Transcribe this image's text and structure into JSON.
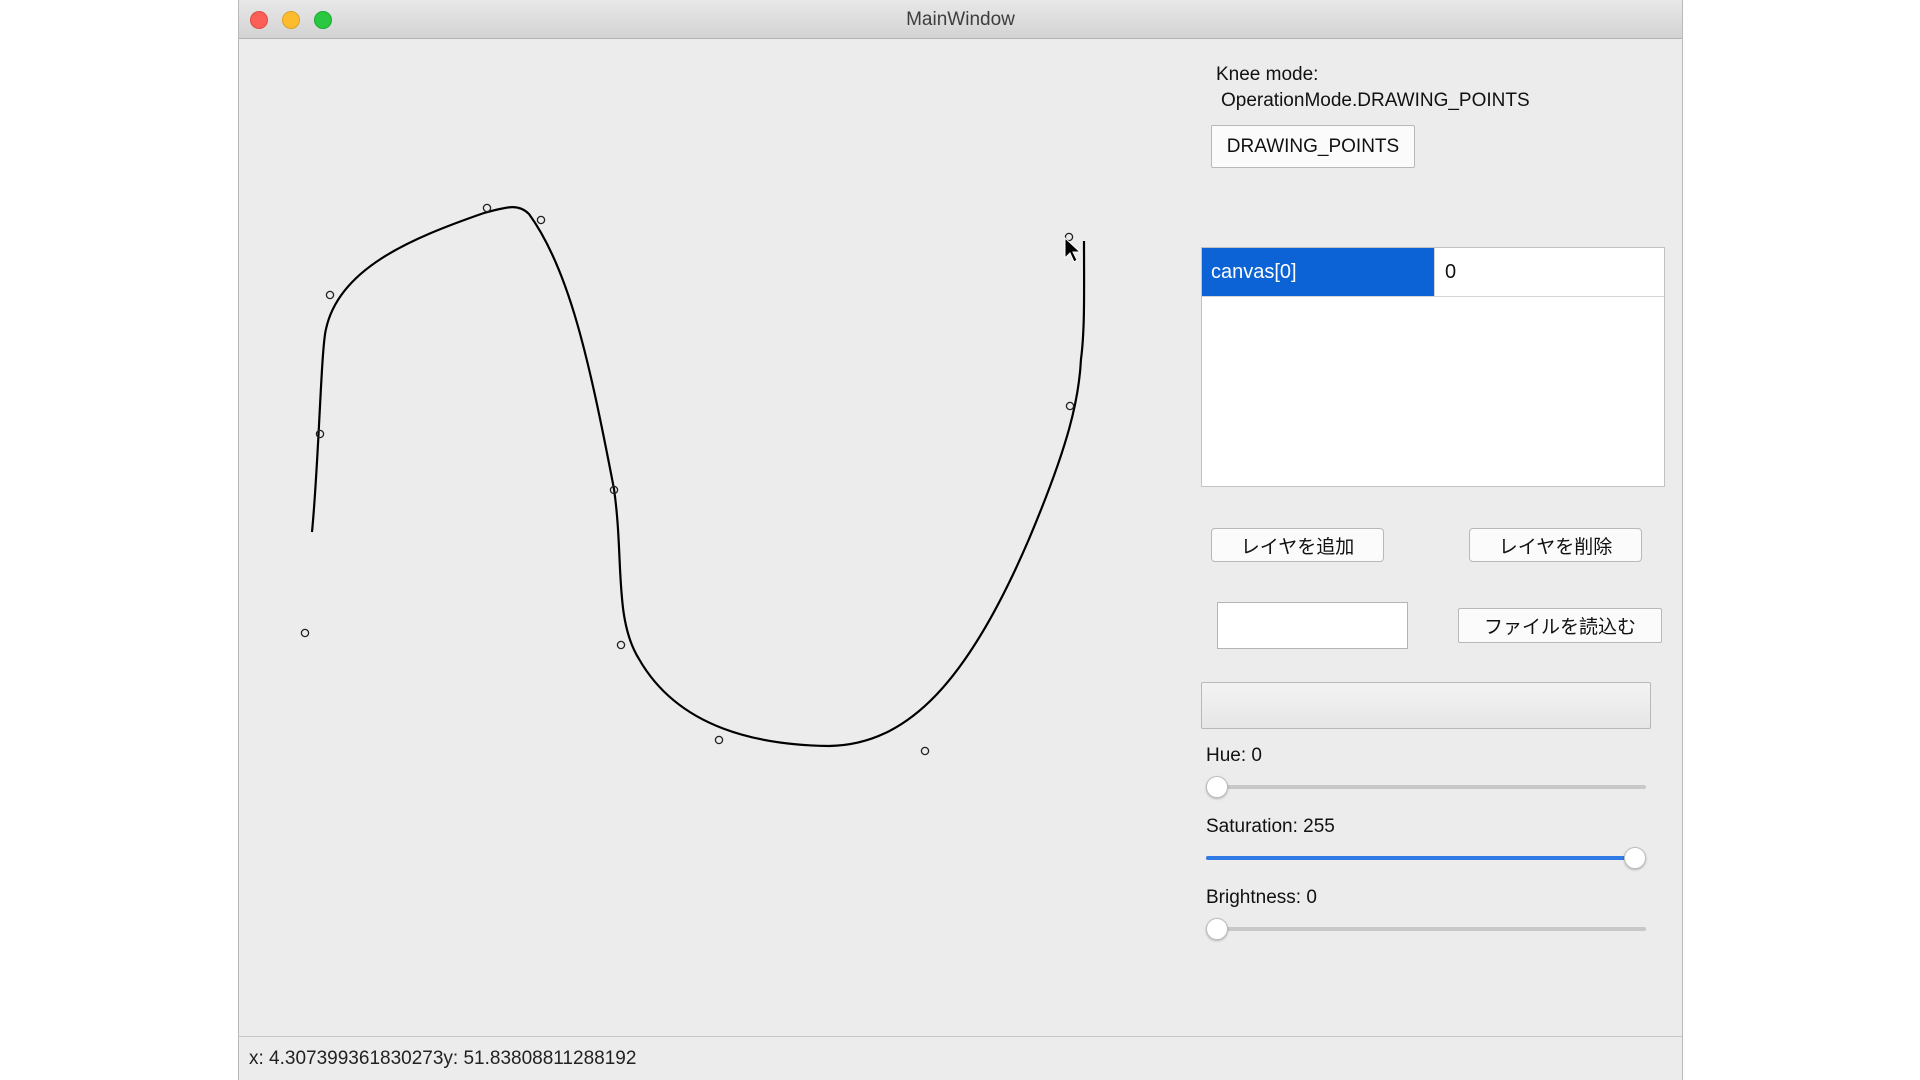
{
  "window": {
    "title": "MainWindow"
  },
  "mode": {
    "label_line1": "Knee mode:",
    "label_line2": "OperationMode.DRAWING_POINTS",
    "button_label": "DRAWING_POINTS"
  },
  "layers": {
    "rows": [
      {
        "name": "canvas[0]",
        "value": "0"
      }
    ]
  },
  "layer_buttons": {
    "add_label": "レイヤを追加",
    "delete_label": "レイヤを削除"
  },
  "file": {
    "input_value": "",
    "read_label": "ファイルを読込む"
  },
  "progress": {
    "value": 0
  },
  "sliders": {
    "hue": {
      "label": "Hue: 0",
      "value": 0,
      "max": 255
    },
    "saturation": {
      "label": "Saturation: 255",
      "value": 255,
      "max": 255
    },
    "brightness": {
      "label": "Brightness: 0",
      "value": 0,
      "max": 255
    }
  },
  "status": {
    "text": "x: 4.307399361830273y: 51.83808811288192"
  },
  "colors": {
    "selection": "#0b63d6",
    "slider_accent": "#2f7ae5",
    "curve": "#000000"
  }
}
